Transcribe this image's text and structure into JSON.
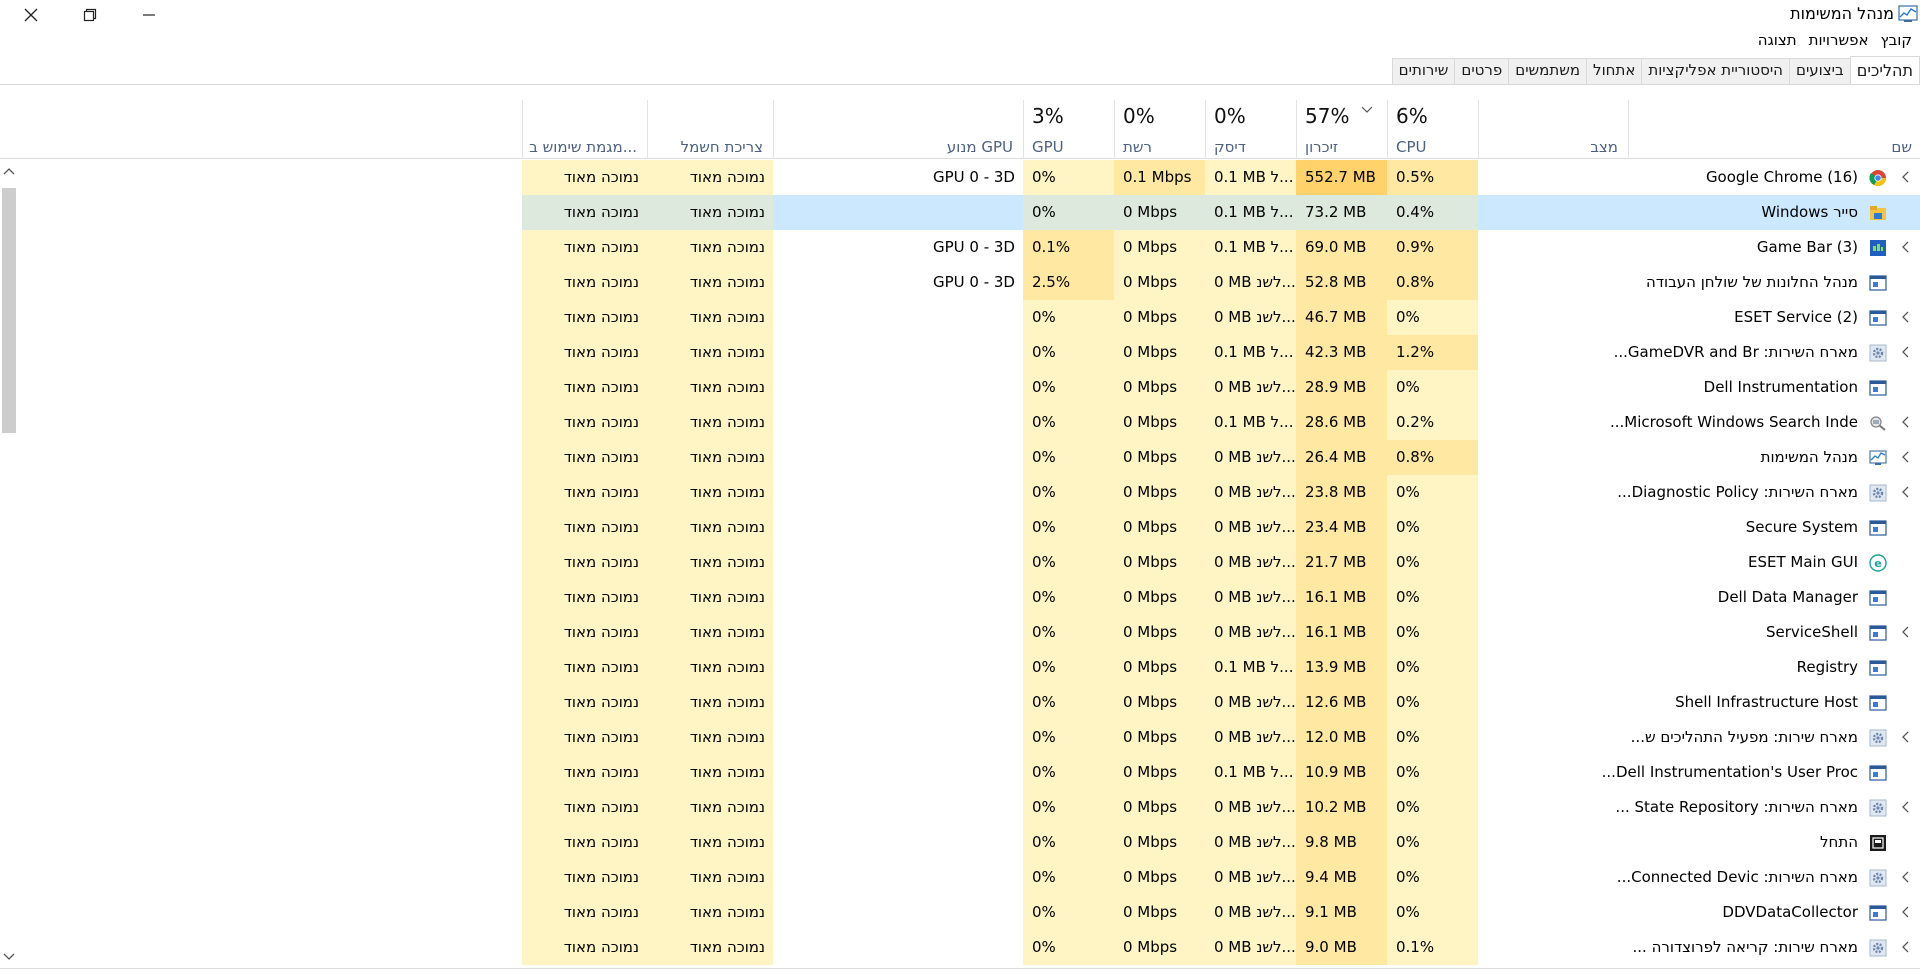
{
  "window": {
    "title": "מנהל המשימות"
  },
  "menu": [
    "קובץ",
    "אפשרויות",
    "תצוגה"
  ],
  "tabs": [
    "תהליכים",
    "ביצועים",
    "היסטוריית אפליקציות",
    "אתחול",
    "משתמשים",
    "פרטים",
    "שירותים"
  ],
  "columns": {
    "name": "שם",
    "status": "מצב",
    "cpu": {
      "pct": "6%",
      "label": "CPU"
    },
    "memory": {
      "pct": "57%",
      "label": "זיכרון"
    },
    "disk": {
      "pct": "0%",
      "label": "דיסק"
    },
    "network": {
      "pct": "0%",
      "label": "רשת"
    },
    "gpu": {
      "pct": "3%",
      "label": "GPU"
    },
    "gpu_engine": "מנוע GPU",
    "power": "צריכת חשמל",
    "power_trend": "מגמת שימוש ב..."
  },
  "rows": [
    {
      "name": "Google Chrome (16)",
      "icon": "chrome-icon",
      "expand": true,
      "cpu": "0.5%",
      "mem": "552.7 MB",
      "disk": "0.1 MB ל...",
      "net": "0.1 Mbps",
      "gpu": "0%",
      "engine": "GPU 0 - 3D",
      "power": "נמוכה מאוד",
      "trend": "נמוכה מאוד"
    },
    {
      "name": "סייר Windows",
      "icon": "folder-icon",
      "expand": false,
      "cpu": "0.4%",
      "mem": "73.2 MB",
      "disk": "0.1 MB ל...",
      "net": "0 Mbps",
      "gpu": "0%",
      "engine": "",
      "power": "נמוכה מאוד",
      "trend": "נמוכה מאוד"
    },
    {
      "name": "Game Bar (3)",
      "icon": "gamebar-icon",
      "expand": true,
      "cpu": "0.9%",
      "mem": "69.0 MB",
      "disk": "0.1 MB ל...",
      "net": "0 Mbps",
      "gpu": "0.1%",
      "engine": "GPU 0 - 3D",
      "power": "נמוכה מאוד",
      "trend": "נמוכה מאוד"
    },
    {
      "name": "מנהל החלונות של שולחן העבודה",
      "icon": "app-icon",
      "expand": false,
      "cpu": "0.8%",
      "mem": "52.8 MB",
      "disk": "0 MB לשנ...",
      "net": "0 Mbps",
      "gpu": "2.5%",
      "engine": "GPU 0 - 3D",
      "power": "נמוכה מאוד",
      "trend": "נמוכה מאוד"
    },
    {
      "name": "ESET Service (2)",
      "icon": "app-icon",
      "expand": true,
      "cpu": "0%",
      "mem": "46.7 MB",
      "disk": "0 MB לשנ...",
      "net": "0 Mbps",
      "gpu": "0%",
      "engine": "",
      "power": "נמוכה מאוד",
      "trend": "נמוכה מאוד"
    },
    {
      "name": "מארח השירות: GameDVR and Br...",
      "icon": "gear-icon",
      "expand": true,
      "cpu": "1.2%",
      "mem": "42.3 MB",
      "disk": "0.1 MB ל...",
      "net": "0 Mbps",
      "gpu": "0%",
      "engine": "",
      "power": "נמוכה מאוד",
      "trend": "נמוכה מאוד"
    },
    {
      "name": "Dell Instrumentation",
      "icon": "app-icon",
      "expand": false,
      "cpu": "0%",
      "mem": "28.9 MB",
      "disk": "0 MB לשנ...",
      "net": "0 Mbps",
      "gpu": "0%",
      "engine": "",
      "power": "נמוכה מאוד",
      "trend": "נמוכה מאוד"
    },
    {
      "name": "Microsoft Windows Search Inde...",
      "icon": "search-indexer-icon",
      "expand": true,
      "cpu": "0.2%",
      "mem": "28.6 MB",
      "disk": "0.1 MB ל...",
      "net": "0 Mbps",
      "gpu": "0%",
      "engine": "",
      "power": "נמוכה מאוד",
      "trend": "נמוכה מאוד"
    },
    {
      "name": "מנהל המשימות",
      "icon": "taskmgr-icon",
      "expand": true,
      "cpu": "0.8%",
      "mem": "26.4 MB",
      "disk": "0 MB לשנ...",
      "net": "0 Mbps",
      "gpu": "0%",
      "engine": "",
      "power": "נמוכה מאוד",
      "trend": "נמוכה מאוד"
    },
    {
      "name": "מארח השירות: Diagnostic Policy...",
      "icon": "gear-icon",
      "expand": true,
      "cpu": "0%",
      "mem": "23.8 MB",
      "disk": "0 MB לשנ...",
      "net": "0 Mbps",
      "gpu": "0%",
      "engine": "",
      "power": "נמוכה מאוד",
      "trend": "נמוכה מאוד"
    },
    {
      "name": "Secure System",
      "icon": "app-icon",
      "expand": false,
      "cpu": "0%",
      "mem": "23.4 MB",
      "disk": "0 MB לשנ...",
      "net": "0 Mbps",
      "gpu": "0%",
      "engine": "",
      "power": "נמוכה מאוד",
      "trend": "נמוכה מאוד"
    },
    {
      "name": "ESET Main GUI",
      "icon": "eset-icon",
      "expand": false,
      "cpu": "0%",
      "mem": "21.7 MB",
      "disk": "0 MB לשנ...",
      "net": "0 Mbps",
      "gpu": "0%",
      "engine": "",
      "power": "נמוכה מאוד",
      "trend": "נמוכה מאוד"
    },
    {
      "name": "Dell Data Manager",
      "icon": "app-icon",
      "expand": false,
      "cpu": "0%",
      "mem": "16.1 MB",
      "disk": "0 MB לשנ...",
      "net": "0 Mbps",
      "gpu": "0%",
      "engine": "",
      "power": "נמוכה מאוד",
      "trend": "נמוכה מאוד"
    },
    {
      "name": "ServiceShell",
      "icon": "app-icon",
      "expand": true,
      "cpu": "0%",
      "mem": "16.1 MB",
      "disk": "0 MB לשנ...",
      "net": "0 Mbps",
      "gpu": "0%",
      "engine": "",
      "power": "נמוכה מאוד",
      "trend": "נמוכה מאוד"
    },
    {
      "name": "Registry",
      "icon": "app-icon",
      "expand": false,
      "cpu": "0%",
      "mem": "13.9 MB",
      "disk": "0.1 MB ל...",
      "net": "0 Mbps",
      "gpu": "0%",
      "engine": "",
      "power": "נמוכה מאוד",
      "trend": "נמוכה מאוד"
    },
    {
      "name": "Shell Infrastructure Host",
      "icon": "app-icon",
      "expand": false,
      "cpu": "0%",
      "mem": "12.6 MB",
      "disk": "0 MB לשנ...",
      "net": "0 Mbps",
      "gpu": "0%",
      "engine": "",
      "power": "נמוכה מאוד",
      "trend": "נמוכה מאוד"
    },
    {
      "name": "מארח שירות: מפעיל התהליכים ש...",
      "icon": "gear-icon",
      "expand": true,
      "cpu": "0%",
      "mem": "12.0 MB",
      "disk": "0 MB לשנ...",
      "net": "0 Mbps",
      "gpu": "0%",
      "engine": "",
      "power": "נמוכה מאוד",
      "trend": "נמוכה מאוד"
    },
    {
      "name": "Dell Instrumentation's User Proc...",
      "icon": "app-icon",
      "expand": false,
      "cpu": "0%",
      "mem": "10.9 MB",
      "disk": "0.1 MB ל...",
      "net": "0 Mbps",
      "gpu": "0%",
      "engine": "",
      "power": "נמוכה מאוד",
      "trend": "נמוכה מאוד"
    },
    {
      "name": "מארח השירות: State Repository ...",
      "icon": "gear-icon",
      "expand": true,
      "cpu": "0%",
      "mem": "10.2 MB",
      "disk": "0 MB לשנ...",
      "net": "0 Mbps",
      "gpu": "0%",
      "engine": "",
      "power": "נמוכה מאוד",
      "trend": "נמוכה מאוד"
    },
    {
      "name": "התחל",
      "icon": "start-icon",
      "expand": false,
      "cpu": "0%",
      "mem": "9.8 MB",
      "disk": "0 MB לשנ...",
      "net": "0 Mbps",
      "gpu": "0%",
      "engine": "",
      "power": "נמוכה מאוד",
      "trend": "נמוכה מאוד"
    },
    {
      "name": "מארח השירות: Connected Devic...",
      "icon": "gear-icon",
      "expand": true,
      "cpu": "0%",
      "mem": "9.4 MB",
      "disk": "0 MB לשנ...",
      "net": "0 Mbps",
      "gpu": "0%",
      "engine": "",
      "power": "נמוכה מאוד",
      "trend": "נמוכה מאוד"
    },
    {
      "name": "DDVDataCollector",
      "icon": "app-icon",
      "expand": true,
      "cpu": "0%",
      "mem": "9.1 MB",
      "disk": "0 MB לשנ...",
      "net": "0 Mbps",
      "gpu": "0%",
      "engine": "",
      "power": "נמוכה מאוד",
      "trend": "נמוכה מאוד"
    },
    {
      "name": "מארח שירות: קריאה לפרוצדורה ...",
      "icon": "gear-icon",
      "expand": true,
      "cpu": "0.1%",
      "mem": "9.0 MB",
      "disk": "0 MB לשנ...",
      "net": "0 Mbps",
      "gpu": "0%",
      "engine": "",
      "power": "נמוכה מאוד",
      "trend": "נמוכה מאוד"
    }
  ],
  "selected_row": 1,
  "colors": {
    "heat": "#fff4c4",
    "heat_mid": "#ffe8a1",
    "heat_high": "#ffd26c",
    "selected": "#cce8ff",
    "header_text": "#4d6080"
  }
}
